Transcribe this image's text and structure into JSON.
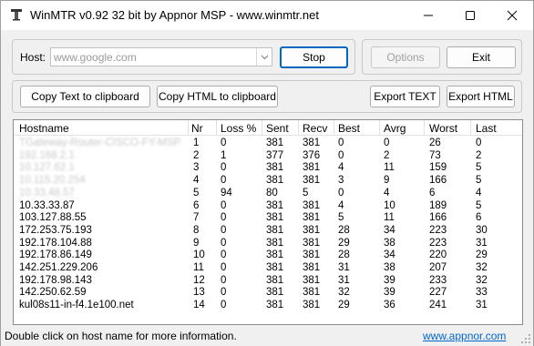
{
  "window": {
    "title": "WinMTR v0.92 32 bit by Appnor MSP - www.winmtr.net",
    "controls": {
      "minimize": "–",
      "maximize": "☐",
      "close": "✕"
    }
  },
  "host": {
    "label": "Host:",
    "value": "www.google.com"
  },
  "buttons": {
    "stop": "Stop",
    "options": "Options",
    "exit": "Exit",
    "copy_text": "Copy Text to clipboard",
    "copy_html": "Copy HTML to clipboard",
    "export_text": "Export TEXT",
    "export_html": "Export HTML"
  },
  "table": {
    "columns": [
      "Hostname",
      "Nr",
      "Loss %",
      "Sent",
      "Recv",
      "Best",
      "Avrg",
      "Worst",
      "Last"
    ],
    "rows": [
      {
        "hostname": "TGateway-Router-CISCO-FY-MSP",
        "blurred": true,
        "nr": "1",
        "loss": "0",
        "sent": "381",
        "recv": "381",
        "best": "0",
        "avrg": "0",
        "worst": "26",
        "last": "0"
      },
      {
        "hostname": "192.168.2.1",
        "blurred": true,
        "nr": "2",
        "loss": "1",
        "sent": "377",
        "recv": "376",
        "best": "0",
        "avrg": "2",
        "worst": "73",
        "last": "2"
      },
      {
        "hostname": "10.127.62.1",
        "blurred": true,
        "nr": "3",
        "loss": "0",
        "sent": "381",
        "recv": "381",
        "best": "4",
        "avrg": "11",
        "worst": "159",
        "last": "5"
      },
      {
        "hostname": "10.115.20.254",
        "blurred": true,
        "nr": "4",
        "loss": "0",
        "sent": "381",
        "recv": "381",
        "best": "3",
        "avrg": "9",
        "worst": "166",
        "last": "5"
      },
      {
        "hostname": "10.33.48.57",
        "blurred": true,
        "nr": "5",
        "loss": "94",
        "sent": "80",
        "recv": "5",
        "best": "0",
        "avrg": "4",
        "worst": "6",
        "last": "4"
      },
      {
        "hostname": "10.33.33.87",
        "blurred": false,
        "nr": "6",
        "loss": "0",
        "sent": "381",
        "recv": "381",
        "best": "4",
        "avrg": "10",
        "worst": "189",
        "last": "5"
      },
      {
        "hostname": "103.127.88.55",
        "blurred": false,
        "nr": "7",
        "loss": "0",
        "sent": "381",
        "recv": "381",
        "best": "5",
        "avrg": "11",
        "worst": "166",
        "last": "6"
      },
      {
        "hostname": "172.253.75.193",
        "blurred": false,
        "nr": "8",
        "loss": "0",
        "sent": "381",
        "recv": "381",
        "best": "28",
        "avrg": "34",
        "worst": "223",
        "last": "30"
      },
      {
        "hostname": "192.178.104.88",
        "blurred": false,
        "nr": "9",
        "loss": "0",
        "sent": "381",
        "recv": "381",
        "best": "29",
        "avrg": "38",
        "worst": "223",
        "last": "31"
      },
      {
        "hostname": "192.178.86.149",
        "blurred": false,
        "nr": "10",
        "loss": "0",
        "sent": "381",
        "recv": "381",
        "best": "28",
        "avrg": "34",
        "worst": "220",
        "last": "29"
      },
      {
        "hostname": "142.251.229.206",
        "blurred": false,
        "nr": "11",
        "loss": "0",
        "sent": "381",
        "recv": "381",
        "best": "31",
        "avrg": "38",
        "worst": "207",
        "last": "32"
      },
      {
        "hostname": "192.178.98.143",
        "blurred": false,
        "nr": "12",
        "loss": "0",
        "sent": "381",
        "recv": "381",
        "best": "31",
        "avrg": "39",
        "worst": "233",
        "last": "32"
      },
      {
        "hostname": "142.250.62.59",
        "blurred": false,
        "nr": "13",
        "loss": "0",
        "sent": "381",
        "recv": "381",
        "best": "32",
        "avrg": "39",
        "worst": "227",
        "last": "33"
      },
      {
        "hostname": "kul08s11-in-f4.1e100.net",
        "blurred": false,
        "nr": "14",
        "loss": "0",
        "sent": "381",
        "recv": "381",
        "best": "29",
        "avrg": "36",
        "worst": "241",
        "last": "31"
      }
    ]
  },
  "status": {
    "message": "Double click on host name for more information.",
    "link": "www.appnor.com"
  },
  "colors": {
    "accent": "#0067c0",
    "link": "#0066cc",
    "window_bg": "#f0f0f0"
  }
}
